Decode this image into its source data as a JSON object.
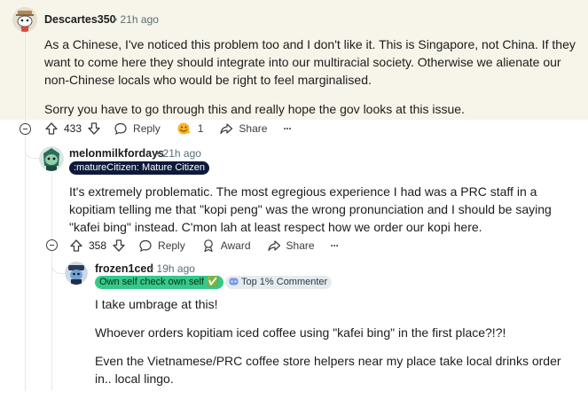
{
  "comment1": {
    "username": "Descartes350",
    "time": "• 21h ago",
    "paragraphs": [
      "As a Chinese, I've noticed this problem too and I don't like it. This is Singapore, not China. If they want to come here they should integrate into our multiracial society. Otherwise we alienate our non-Chinese locals who would be right to feel marginalised.",
      "Sorry you have to go through this and really hope the gov looks at this issue."
    ],
    "upvotes": "433",
    "reply_label": "Reply",
    "award_count": "1",
    "share_label": "Share",
    "more_label": "···"
  },
  "comment2": {
    "username": "melonmilkfordays",
    "time": "• 21h ago",
    "flair": ":matureCitizen: Mature Citizen",
    "paragraphs": [
      "It's extremely problematic. The most egregious experience I had was a PRC staff in a kopitiam telling me that \"kopi peng\" was the wrong pronunciation and I should be saying \"kafei bing\" instead. C'mon lah at least respect how we order our kopi here."
    ],
    "upvotes": "358",
    "reply_label": "Reply",
    "award_label": "Award",
    "share_label": "Share",
    "more_label": "···"
  },
  "comment3": {
    "username": "frozen1ced",
    "time": "• 19h ago",
    "flair": "Own self check own self ✅",
    "badge": "Top 1% Commenter",
    "paragraphs": [
      "I take umbrage at this!",
      "Whoever orders kopitiam iced coffee using \"kafei bing\" in the first place?!?!",
      "Even the Vietnamese/PRC coffee store helpers near my place take local drinks order in.. local lingo."
    ]
  },
  "colors": {
    "highlight_bg": "#f7f4ea",
    "meta_text": "#576f76",
    "flair_dark": "#0e1a3a",
    "flair_green": "#35c98a",
    "badge_bg": "#e5ebee"
  }
}
